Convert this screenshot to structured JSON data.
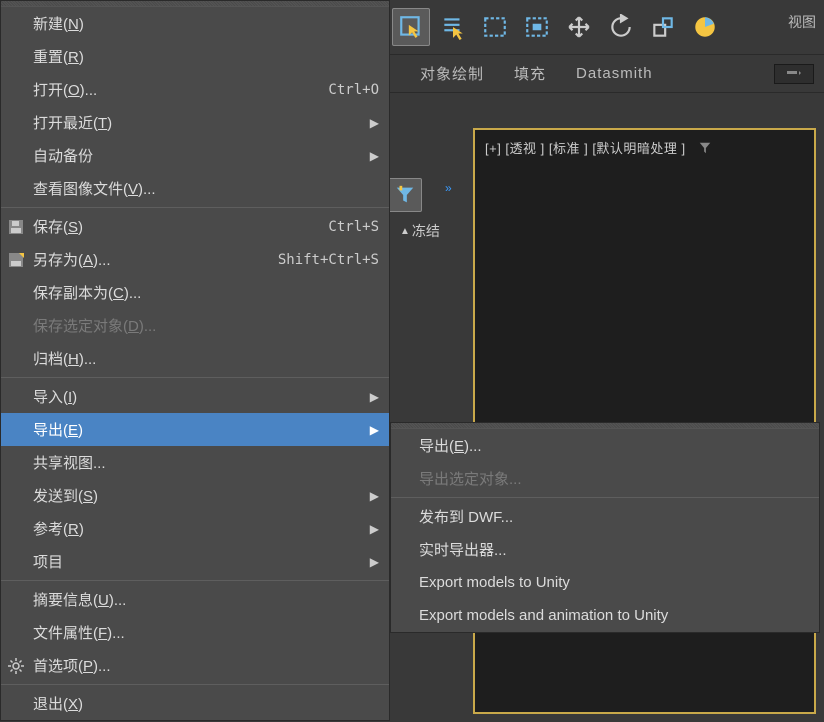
{
  "toolbar": {
    "view_label": "视图",
    "sub": [
      {
        "label": "对象绘制"
      },
      {
        "label": "填充"
      },
      {
        "label": "Datasmith"
      }
    ]
  },
  "sidebar": {
    "freeze_label": "冻结"
  },
  "viewport": {
    "header": "[+] [透视 ] [标准 ] [默认明暗处理 ]"
  },
  "menu": {
    "items": [
      {
        "label": "新建(N)",
        "type": "item"
      },
      {
        "label": "重置(R)",
        "type": "item"
      },
      {
        "label": "打开(O)...",
        "shortcut": "Ctrl+O",
        "type": "item"
      },
      {
        "label": "打开最近(T)",
        "submenu": true,
        "type": "item"
      },
      {
        "label": "自动备份",
        "submenu": true,
        "type": "item"
      },
      {
        "label": "查看图像文件(V)...",
        "type": "item"
      },
      {
        "type": "sep"
      },
      {
        "label": "保存(S)",
        "shortcut": "Ctrl+S",
        "icon": "save",
        "type": "item"
      },
      {
        "label": "另存为(A)...",
        "shortcut": "Shift+Ctrl+S",
        "icon": "saveas",
        "type": "item"
      },
      {
        "label": "保存副本为(C)...",
        "type": "item"
      },
      {
        "label": "保存选定对象(D)...",
        "disabled": true,
        "type": "item"
      },
      {
        "label": "归档(H)...",
        "type": "item"
      },
      {
        "type": "sep"
      },
      {
        "label": "导入(I)",
        "submenu": true,
        "type": "item"
      },
      {
        "label": "导出(E)",
        "submenu": true,
        "highlighted": true,
        "type": "item"
      },
      {
        "label": "共享视图...",
        "type": "item"
      },
      {
        "label": "发送到(S)",
        "submenu": true,
        "type": "item"
      },
      {
        "label": "参考(R)",
        "submenu": true,
        "type": "item"
      },
      {
        "label": "项目",
        "submenu": true,
        "type": "item"
      },
      {
        "type": "sep"
      },
      {
        "label": "摘要信息(U)...",
        "type": "item"
      },
      {
        "label": "文件属性(F)...",
        "type": "item"
      },
      {
        "label": "首选项(P)...",
        "icon": "gear",
        "type": "item"
      },
      {
        "type": "sep"
      },
      {
        "label": "退出(X)",
        "type": "item"
      }
    ]
  },
  "submenu": {
    "items": [
      {
        "label": "导出(E)..."
      },
      {
        "label": "导出选定对象...",
        "disabled": true
      },
      {
        "type": "sep"
      },
      {
        "label": "发布到 DWF..."
      },
      {
        "label": "实时导出器..."
      },
      {
        "label": "Export models to Unity"
      },
      {
        "label": "Export models and animation to Unity"
      }
    ]
  }
}
